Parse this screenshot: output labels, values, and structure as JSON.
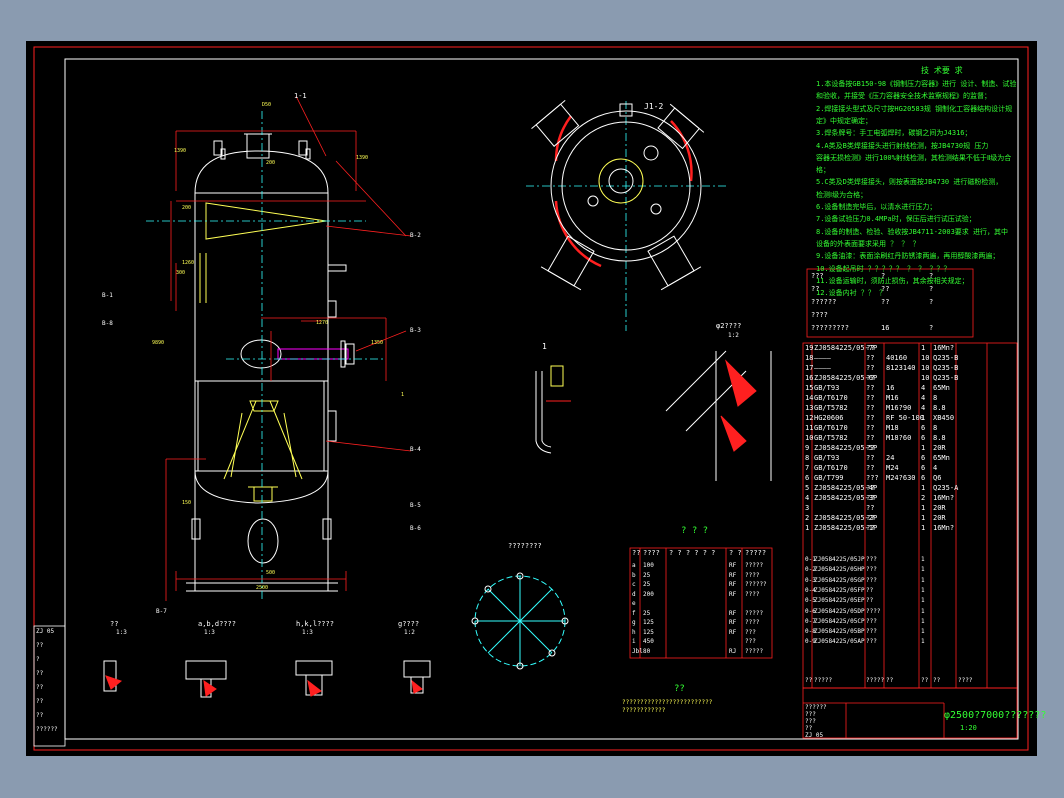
{
  "colors": {
    "background": "#8a9bb0",
    "sheet": "#000000",
    "frame": "#ff2020",
    "outline": "#ffffff",
    "text": "#33ff33",
    "dim": "#ff2020",
    "centerline": "#33ffff",
    "fill": "#ffff55",
    "pipe": "#ff00ff"
  },
  "tech_requirements": {
    "title": "技 术要 求",
    "lines": [
      "1.本设备按GB150-98《钢制压力容器》进行 设计、制造、试验",
      "和验收，并接受《压力容器安全技术监察规程》的监督；",
      "2.焊接接头型式及尺寸按HG20583规 钢制化工容器结构设计规",
      "定》中规定确定；",
      "3.焊条牌号：手工电弧焊时，碳钢之间为J4316；",
      "4.A类及B类焊接接头进行射线检测，按JB4730规 压力",
      "容器无损检测》进行100%射线检测，其检测结果不低于Ⅱ级为合",
      "格；",
      "5.C类及D类焊接接头，则按表面按JB4730 进行磁粉检测，",
      "检测Ⅰ级为合格；",
      "6.设备制造完毕后，以清水进行压力；",
      "7.设备试验压力0.4MPa时，保压后进行试压试验；",
      "8.设备的制造、检验、验收按JB4711-2003要求 进行，其中",
      "设备的外表面要求采用 ？ ？ ？",
      "9.设备油漆：表面涂刷红丹防锈漆两遍，再用醇酸漆两遍；",
      "10.设备起吊时 ？？？？？ ？ ？ ？？？",
      "11.设备运输时，须防止损伤，其余按相关规定；",
      "12.设备内衬 ？？ ？"
    ]
  },
  "design_data": {
    "rows": [
      [
        "???",
        "?",
        "?"
      ],
      [
        "??",
        "??",
        "?"
      ],
      [
        "??????",
        "??",
        "?"
      ],
      [
        "????",
        "",
        ""
      ],
      [
        "?????????",
        "16",
        "?"
      ]
    ]
  },
  "parts_list": {
    "rows": [
      [
        "19",
        "ZJ0584225/05-7P",
        "??",
        "",
        "1",
        "16Mn?",
        ""
      ],
      [
        "18",
        "————",
        "??",
        "40160",
        "10",
        "Q235-B",
        ""
      ],
      [
        "17",
        "————",
        "??",
        "8123140",
        "10",
        "Q235-B",
        ""
      ],
      [
        "16",
        "ZJ0584225/05-6P",
        "??",
        "",
        "10",
        "Q235-B",
        ""
      ],
      [
        "15",
        "GB/T93",
        "??",
        "16",
        "4",
        "65Mn",
        ""
      ],
      [
        "14",
        "GB/T6170",
        "??",
        "M16",
        "4",
        "8",
        ""
      ],
      [
        "13",
        "GB/T5782",
        "??",
        "M16?90",
        "4",
        "8.8",
        ""
      ],
      [
        "12",
        "HG20606",
        "??",
        "RF 50-100",
        "1",
        "XB450",
        ""
      ],
      [
        "11",
        "GB/T6170",
        "??",
        "M18",
        "6",
        "8",
        ""
      ],
      [
        "10",
        "GB/T5782",
        "??",
        "M18?60",
        "6",
        "8.8",
        ""
      ],
      [
        "9",
        "ZJ0584225/05-5P",
        "??",
        "",
        "1",
        "20R",
        ""
      ],
      [
        "8",
        "GB/T93",
        "??",
        "24",
        "6",
        "65Mn",
        ""
      ],
      [
        "7",
        "GB/T6170",
        "??",
        "M24",
        "6",
        "4",
        ""
      ],
      [
        "6",
        "GB/T799",
        "???",
        "M24?630",
        "6",
        "Q6",
        ""
      ],
      [
        "5",
        "ZJ0584225/05-4P",
        "??",
        "",
        "1",
        "Q235-A",
        ""
      ],
      [
        "4",
        "ZJ0584225/05-3P",
        "??",
        "",
        "2",
        "16Mn?",
        ""
      ],
      [
        "3",
        "",
        "??",
        "",
        "1",
        "20R",
        ""
      ],
      [
        "2",
        "ZJ0584225/05-2P",
        "??",
        "",
        "1",
        "20R",
        ""
      ],
      [
        "1",
        "ZJ0584225/05-1P",
        "??",
        "",
        "1",
        "16Mn?",
        ""
      ]
    ],
    "drawings": [
      [
        "0-1",
        "ZJ0584225/05JP",
        "???",
        "",
        "1"
      ],
      [
        "0-2",
        "ZJ0584225/05HP",
        "???",
        "",
        "1"
      ],
      [
        "0-3",
        "ZJ0584225/05GP",
        "???",
        "",
        "1"
      ],
      [
        "0-4",
        "ZJ0584225/05FP",
        "??",
        "",
        "1"
      ],
      [
        "0-5",
        "ZJ0584225/05EP",
        "??",
        "",
        "1"
      ],
      [
        "0-6",
        "ZJ0584225/05DP",
        "????",
        "",
        "1"
      ],
      [
        "0-7",
        "ZJ0584225/05CP",
        "???",
        "",
        "1"
      ],
      [
        "0-8",
        "ZJ0584225/05BP",
        "???",
        "",
        "1"
      ],
      [
        "0-9",
        "ZJ0584225/05AP",
        "???",
        "",
        "1"
      ]
    ],
    "footer": [
      "??",
      "?????",
      "?????",
      "??",
      "??",
      "??",
      "????"
    ]
  },
  "nozzle_table": {
    "title": "? ? ?",
    "header": [
      "??",
      "????",
      "? ? ? ? ? ?",
      "? ?",
      "?????"
    ],
    "rows": [
      [
        "a",
        "100",
        "",
        "RF",
        "?????"
      ],
      [
        "b",
        "25",
        "",
        "RF",
        "????"
      ],
      [
        "c",
        "25",
        "",
        "RF",
        "??????"
      ],
      [
        "d",
        "200",
        "",
        "RF",
        "????"
      ],
      [
        "e",
        "",
        "",
        "",
        ""
      ],
      [
        "f",
        "25",
        "",
        "RF",
        "?????"
      ],
      [
        "g",
        "125",
        "",
        "RF",
        "????"
      ],
      [
        "h",
        "125",
        "",
        "RF",
        "???"
      ],
      [
        "i",
        "450",
        "",
        "",
        "???"
      ],
      [
        "Jbl",
        "80",
        "",
        "RJ",
        "?????"
      ]
    ]
  },
  "title_block": {
    "name": "φ2500?7000???????",
    "scale": "1:20",
    "material": "ZJ 05",
    "left_rows": [
      "??????",
      "???",
      "???",
      "??",
      "ZJ 05"
    ],
    "code": "ZJ0584225/05"
  },
  "revision_block": [
    "ZJ 05",
    "??",
    "?",
    "??",
    "??",
    "??",
    "??",
    "??????"
  ],
  "views": {
    "front_top_label": "1-1",
    "top_view_label": "J1-2",
    "labels_main": [
      "B-1",
      "B-2",
      "B-3",
      "B-4",
      "B-5",
      "B-6",
      "B-7",
      "B-8"
    ],
    "detail_label_1": "1",
    "detail_label_2": "φ2????",
    "detail_label_2b": "1:2",
    "bolt_circle_label": "????????",
    "bottom_label": "??",
    "bottom_note": "?????????????????????????\n????????????",
    "sec_labels": [
      {
        "title": "??",
        "sub": "1:3"
      },
      {
        "title": "a,b,d????",
        "sub": "1:3"
      },
      {
        "title": "h,k,l????",
        "sub": "1:3"
      },
      {
        "title": "g????",
        "sub": "1:2"
      }
    ],
    "dims": [
      "1390",
      "D50",
      "200",
      "300",
      "1270",
      "1350",
      "1260",
      "150",
      "200",
      "1390",
      "9890",
      "500",
      "2500",
      "1"
    ]
  }
}
